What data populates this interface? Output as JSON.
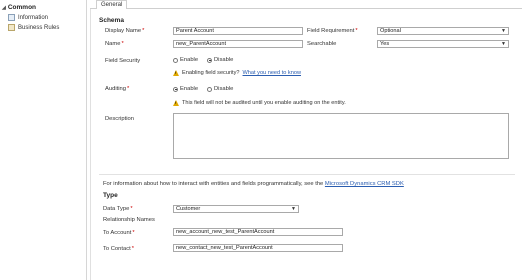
{
  "sidebar": {
    "section_title": "Common",
    "items": [
      {
        "label": "Information",
        "icon": "information-icon"
      },
      {
        "label": "Business Rules",
        "icon": "business-rules-icon"
      }
    ]
  },
  "tabs": [
    {
      "label": "General"
    }
  ],
  "schema": {
    "heading": "Schema",
    "display_name": {
      "label": "Display Name",
      "value": "Parent Account"
    },
    "name": {
      "label": "Name",
      "value": "new_ParentAccount"
    },
    "field_requirement": {
      "label": "Field Requirement",
      "value": "Optional"
    },
    "searchable": {
      "label": "Searchable",
      "value": "Yes"
    },
    "field_security": {
      "label": "Field Security",
      "options": [
        "Enable",
        "Disable"
      ],
      "selected": "Disable",
      "notice": "Enabling field security?",
      "notice_link": "What you need to know"
    },
    "auditing": {
      "label": "Auditing",
      "options": [
        "Enable",
        "Disable"
      ],
      "selected": "Enable",
      "notice": "This field will not be audited until you enable auditing on the entity."
    },
    "description": {
      "label": "Description",
      "value": ""
    }
  },
  "info": {
    "text": "For information about how to interact with entities and fields programmatically, see the",
    "link": "Microsoft Dynamics CRM SDK"
  },
  "type": {
    "heading": "Type",
    "data_type": {
      "label": "Data Type",
      "value": "Customer"
    },
    "relationship_names": "Relationship Names",
    "to_account": {
      "label": "To Account",
      "value": "new_account_new_test_ParentAccount"
    },
    "to_contact": {
      "label": "To Contact",
      "value": "new_contact_new_test_ParentAccount"
    }
  }
}
